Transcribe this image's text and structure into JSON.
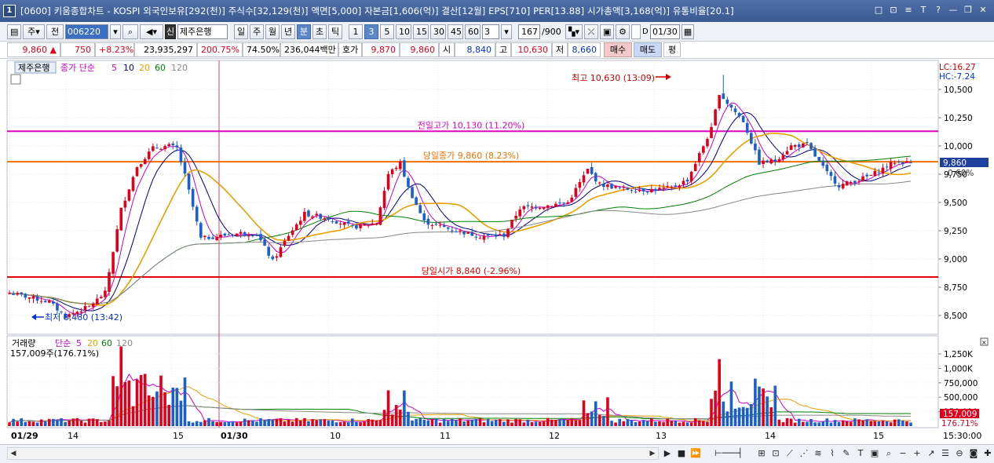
{
  "window": {
    "app_number": "1",
    "title": "[0600] 키움종합차트 - KOSPI 외국인보유[292(천)] 주식수[32,129(천)] 액면[5,000] 자본금[1,606(억)] 결산[12월] EPS[710] PER[13.88] 시가총액[3,168(억)] 유통비율[20.1]",
    "buttons": [
      "□",
      "⊡",
      "≡",
      "T",
      "?",
      "—",
      "❐",
      "✕"
    ]
  },
  "toolbar": {
    "period_type": "주",
    "prev_label": "전",
    "stock_code": "006220",
    "stock_name_prefix": "신",
    "stock_name": "제주은행",
    "period_buttons": [
      "일",
      "주",
      "월",
      "년",
      "분",
      "초",
      "틱"
    ],
    "selected_period": "분",
    "interval_buttons": [
      "1",
      "3",
      "5",
      "10",
      "15",
      "30",
      "45",
      "60"
    ],
    "selected_interval": "3",
    "interval_value": "3",
    "count_value": "167",
    "count_total": "/900",
    "checkbox_label": "D",
    "date_value": "01/30"
  },
  "quote": {
    "price": "9,860",
    "direction": "▲",
    "change": "750",
    "change_pct": "+8.23%",
    "volume": "23,935,297",
    "volume_ratio": "200.75%",
    "turnover_ratio": "74.50%",
    "trade_amount": "236,044백만",
    "hoga_label": "호가",
    "ask": "9,870",
    "bid": "9,860",
    "open_label": "시",
    "open": "8,840",
    "high_label": "고",
    "high": "10,630",
    "low_label": "저",
    "low": "8,660",
    "buy_label": "매수",
    "sell_label": "매도",
    "avg_label": "평"
  },
  "chart_data": [
    {
      "type": "candlestick",
      "title": "제주은행",
      "legend": {
        "series_label": "종가 단순",
        "periods": [
          "5",
          "10",
          "20",
          "60",
          "120"
        ],
        "colors": [
          "#cc00cc",
          "#000080",
          "#e8a000",
          "#008000",
          "#888888"
        ]
      },
      "y_ticks": [
        "10,500",
        "10,250",
        "10,000",
        "9,750",
        "9,500",
        "9,250",
        "9,000",
        "8,750",
        "8,500"
      ],
      "ylim": [
        8350,
        10850
      ],
      "x_ticks": [
        "01/29",
        "14",
        "15",
        "01/30",
        "10",
        "11",
        "12",
        "13",
        "14",
        "15"
      ],
      "corner_labels": {
        "lc": "LC:16.27",
        "hc": "HC:-7.24"
      },
      "current_price_label": "9,860",
      "current_pct_label": "0.60%",
      "hlines": [
        {
          "label": "전일고가 10,130 (11.20%)",
          "value": 10130,
          "color": "#e000c0"
        },
        {
          "label": "당일종가 9,860 (8.23%)",
          "value": 9860,
          "color": "#f07000"
        },
        {
          "label": "당일시가 8,840 (-2.96%)",
          "value": 8840,
          "color": "#e00000"
        }
      ],
      "annotations": {
        "high": "최고 10,630 (13:09)",
        "low": "최저 8,480 (13:42)"
      },
      "colors": {
        "up": "#e0001b",
        "down": "#1a5fcc"
      }
    },
    {
      "type": "bar",
      "title": "거래량",
      "legend": {
        "series_label": "단순",
        "periods": [
          "5",
          "20",
          "60",
          "120"
        ],
        "colors": [
          "#cc00cc",
          "#e8a000",
          "#008000",
          "#888888"
        ]
      },
      "summary": "157,009주(176.71%)",
      "y_ticks": [
        "1,250K",
        "1,000K",
        "750,000",
        "500,000",
        "250,000"
      ],
      "ylim": [
        0,
        1400000
      ],
      "current_value_label": "157,009",
      "current_pct_label": "176.71%",
      "time_label": "15:30:00"
    }
  ]
}
